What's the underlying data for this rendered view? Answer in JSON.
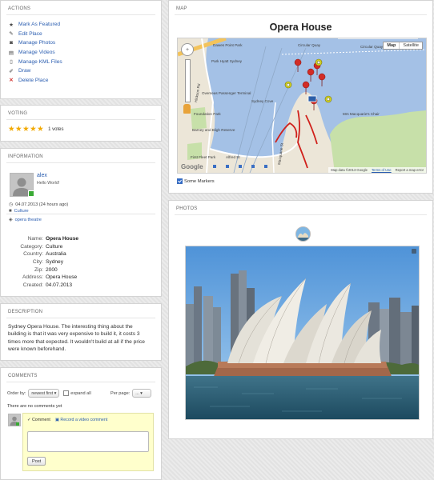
{
  "actions": {
    "title": "ACTIONS",
    "items": [
      {
        "label": "Mark As Featured",
        "icon": "star-icon"
      },
      {
        "label": "Edit Place",
        "icon": "edit-icon"
      },
      {
        "label": "Manage Photos",
        "icon": "camera-icon"
      },
      {
        "label": "Manage Videos",
        "icon": "film-icon"
      },
      {
        "label": "Manage KML Files",
        "icon": "file-icon"
      },
      {
        "label": "Draw",
        "icon": "pencil-icon"
      },
      {
        "label": "Delete Place",
        "icon": "delete-icon"
      }
    ]
  },
  "voting": {
    "title": "VOTING",
    "stars": 5,
    "votes": "1 votes",
    "star_color": "#f2a900"
  },
  "information": {
    "title": "INFORMATION",
    "user": {
      "name": "alex",
      "message": "Hello World!",
      "online_color": "#3aaa35"
    },
    "date": "04.07.2013 (24 hours ago)",
    "category_link": "Culture",
    "tags_link": "opera theatre",
    "details": [
      {
        "key": "Name:",
        "value": "Opera House"
      },
      {
        "key": "Category:",
        "value": "Culture"
      },
      {
        "key": "Country:",
        "value": "Australia"
      },
      {
        "key": "City:",
        "value": "Sydney"
      },
      {
        "key": "Zip:",
        "value": "2000"
      },
      {
        "key": "Address:",
        "value": "Opera House"
      },
      {
        "key": "Created:",
        "value": "04.07.2013"
      }
    ]
  },
  "description": {
    "title": "DESCRIPTION",
    "text": "Sydney Opera House. The interesting thing about the building is that it was very expensive to build it, it costs 3 times more that expected. It wouldn't build at all if the price were known beforehand."
  },
  "comments": {
    "title": "COMMENTS",
    "order_label": "Order by:",
    "order_value": "newest first",
    "expand_label": "expand all",
    "per_page_label": "Per page:",
    "per_page_value": "...",
    "empty_text": "There are no comments yet",
    "tab_comment": "Comment",
    "tab_video": "Record a video comment",
    "post_label": "Post",
    "box_color": "#ffffcc"
  },
  "map": {
    "title": "MAP",
    "heading": "Opera House",
    "btn_map": "Map",
    "btn_satellite": "Satellite",
    "footer_data": "Map data ©2013 Google",
    "footer_terms": "Terms of Use",
    "footer_report": "Report a map error",
    "google": "Google",
    "some_markers": "Some Markers",
    "labels": {
      "circular_quay": "Circular Quay",
      "park_hyatt": "Park Hyatt Sydney",
      "dawes_point": "Dawes Point Park",
      "museum": "Museum of Contemporary Art",
      "overseas": "Overseas Passenger Terminal",
      "foundation_park": "Foundation Park",
      "sydney_cove": "Sydney Cove",
      "barney": "Barney and Bligh Reserve",
      "first_fleet": "First Fleet Park",
      "mrs_macq": "Mrs Macquarie's Chair",
      "macquarie_st": "Macquarie St",
      "hickson_rd": "Hickson Rd",
      "alfred_st": "Alfred St"
    }
  },
  "photos": {
    "title": "PHOTOS"
  }
}
